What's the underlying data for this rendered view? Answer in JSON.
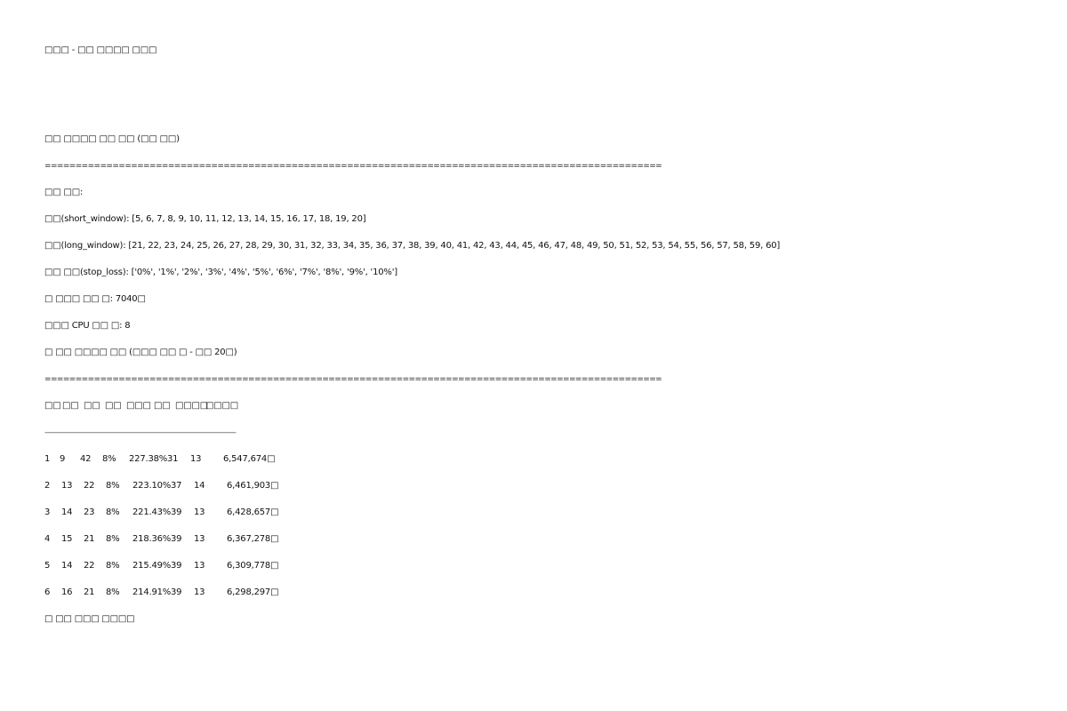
{
  "header": {
    "title": "□□□ - □□ □□□□ □□□"
  },
  "summary": {
    "heading": "□□ □□□□ □□ □□ (□□ □□)",
    "separator": "====================================================================================================",
    "params_label": "□□ □□:",
    "short_window": "□□(short_window): [5, 6, 7, 8, 9, 10, 11, 12, 13, 14, 15, 16, 17, 18, 19, 20]",
    "long_window": "□□(long_window): [21, 22, 23, 24, 25, 26, 27, 28, 29, 30, 31, 32, 33, 34, 35, 36, 37, 38, 39, 40, 41, 42, 43, 44, 45, 46, 47, 48, 49, 50, 51, 52, 53, 54, 55, 56, 57, 58, 59, 60]",
    "stop_loss": "□□ □□(stop_loss): ['0%', '1%', '2%', '3%', '4%', '5%', '6%', '7%', '8%', '9%', '10%']",
    "total_combinations": "□ □□□ □□ □: 7040□",
    "cpu_count": "□□□ CPU □□ □: 8"
  },
  "results": {
    "heading": "□ □□ □□□□ □□ (□□□ □□ □ - □□ 20□)",
    "separator": "====================================================================================================",
    "columns": [
      "□□",
      "□□",
      "□□",
      "□□",
      "□□□",
      "□□",
      "□□□□",
      "□□□□"
    ],
    "divider": "----------------------------------------------------------------------------------------------------",
    "rows": [
      {
        "rank": "1",
        "short": "9",
        "long": "42",
        "stop": "8%",
        "ret": "227.38%",
        "trades": "31",
        "wins": "13",
        "final": "6,547,674□"
      },
      {
        "rank": "2",
        "short": "13",
        "long": "22",
        "stop": "8%",
        "ret": "223.10%",
        "trades": "37",
        "wins": "14",
        "final": "6,461,903□"
      },
      {
        "rank": "3",
        "short": "14",
        "long": "23",
        "stop": "8%",
        "ret": "221.43%",
        "trades": "39",
        "wins": "13",
        "final": "6,428,657□"
      },
      {
        "rank": "4",
        "short": "15",
        "long": "21",
        "stop": "8%",
        "ret": "218.36%",
        "trades": "39",
        "wins": "13",
        "final": "6,367,278□"
      },
      {
        "rank": "5",
        "short": "14",
        "long": "22",
        "stop": "8%",
        "ret": "215.49%",
        "trades": "39",
        "wins": "13",
        "final": "6,309,778□"
      },
      {
        "rank": "6",
        "short": "16",
        "long": "21",
        "stop": "8%",
        "ret": "214.91%",
        "trades": "39",
        "wins": "13",
        "final": "6,298,297□"
      }
    ],
    "footer": "□ □□ □□□ □□□□"
  }
}
